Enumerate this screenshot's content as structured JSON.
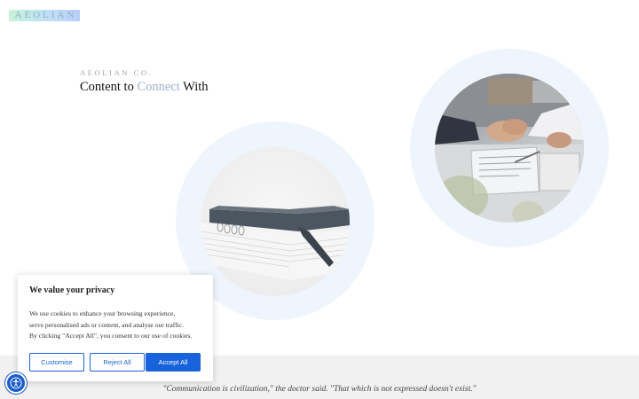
{
  "header": {
    "logo_text": "AEOLIAN"
  },
  "hero": {
    "eyebrow": "AEOLIAN CO.",
    "headline_part1": "Content to ",
    "headline_accent": "Connect",
    "headline_part2": " With"
  },
  "images": {
    "notebook_icon": "notebook-photo",
    "handshake_icon": "handshake-photo"
  },
  "cookie_banner": {
    "title": "We value your privacy",
    "body_line1": "We use cookies to enhance your browsing experience,",
    "body_line2": "serve personalised ads or content, and analyse our traffic.",
    "body_line3": "By clicking \"Accept All\", you consent to our use of cookies.",
    "customise_label": "Customise",
    "reject_label": "Reject All",
    "accept_label": "Accept All"
  },
  "footer": {
    "quote": "\"Communication is civilization,\" the doctor said. \"That which is not expressed doesn't exist.\""
  },
  "accessibility": {
    "icon": "accessibility-icon"
  },
  "colors": {
    "accent": "#1863dc",
    "headline_accent": "#9fb0cf",
    "ring": "#eef5fc"
  }
}
